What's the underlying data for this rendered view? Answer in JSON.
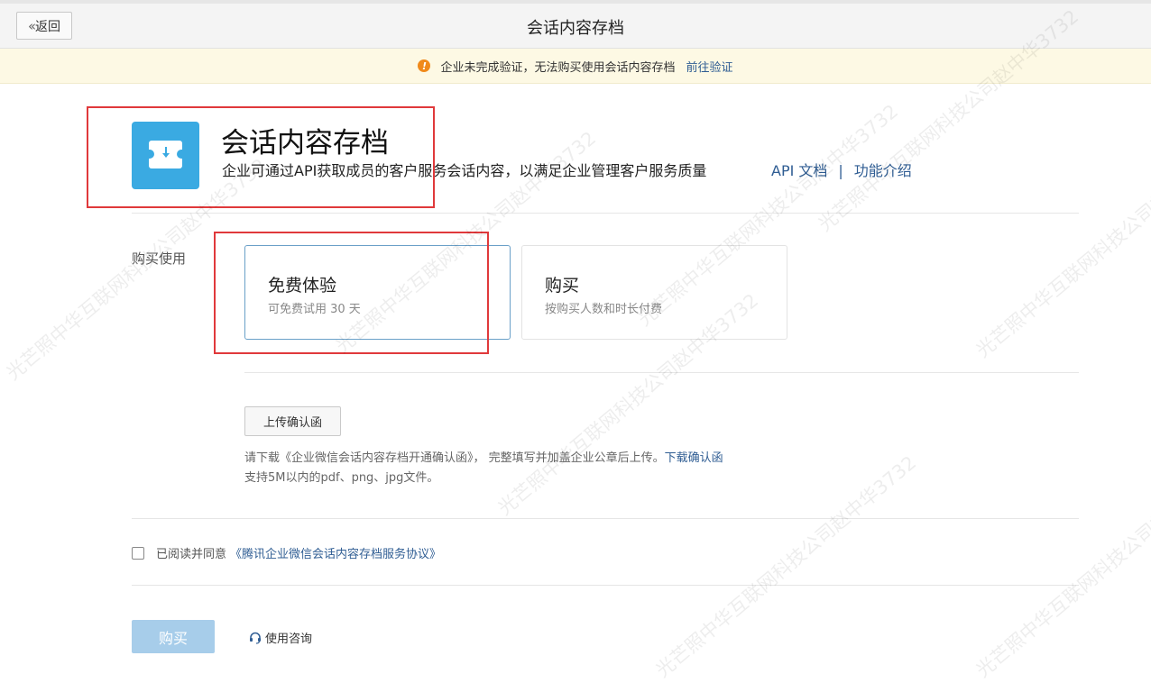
{
  "header": {
    "back_label": "返回",
    "title": "会话内容存档"
  },
  "notice": {
    "icon": "warning-icon",
    "text": "企业未完成验证，无法购买使用会话内容存档",
    "link": "前往验证"
  },
  "app": {
    "icon": "archive-download-icon",
    "name": "会话内容存档",
    "description": "企业可通过API获取成员的客户服务会话内容，以满足企业管理客户服务质量",
    "links": [
      "API 文档",
      "功能介绍"
    ],
    "link_separator": "|"
  },
  "purchase": {
    "label": "购买使用",
    "options": [
      {
        "title": "免费体验",
        "subtitle": "可免费试用 30 天",
        "selected": true
      },
      {
        "title": "购买",
        "subtitle": "按购买人数和时长付费",
        "selected": false
      }
    ]
  },
  "upload": {
    "button_label": "上传确认函",
    "tip_line1": "请下载《企业微信会话内容存档开通确认函》， 完整填写并加盖企业公章后上传。",
    "tip_link": "下载确认函",
    "tip_line2": "支持5M以内的pdf、png、jpg文件。"
  },
  "agreement": {
    "checked": false,
    "text": "已阅读并同意",
    "link": "《腾讯企业微信会话内容存档服务协议》"
  },
  "actions": {
    "buy_label": "购买",
    "consult_label": "使用咨询"
  },
  "watermark": {
    "text": "光芒照中华互联网科技公司赵中华3732"
  },
  "colors": {
    "accent": "#3aaae2",
    "link": "#2f5d93",
    "highlight_box": "#e0393b",
    "buy_button": "#a7cdea",
    "notice_bg": "#fdf9e4",
    "warning": "#f08a1b"
  }
}
